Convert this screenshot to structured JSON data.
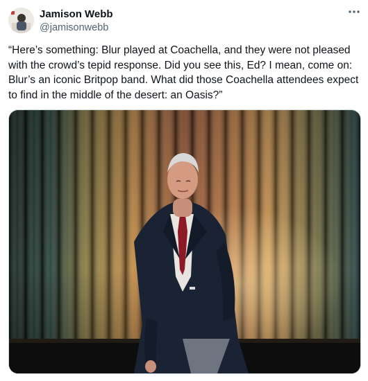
{
  "author": {
    "display_name": "Jamison Webb",
    "handle": "@jamisonwebb",
    "avatar_icon": "person-avatar"
  },
  "more_icon": "ellipsis-icon",
  "tweet": {
    "text": "“Here’s something: Blur played at Coachella, and they were not pleased with the crowd’s tepid response. Did you see this, Ed? I mean, come on: Blur’s an iconic Britpop band. What did those Coachella attendees expect to find in the middle of the desert: an Oasis?”"
  },
  "media": {
    "kind": "photo",
    "palette": {
      "curtain_dark": "#12221c",
      "curtain_teal": "#214a44",
      "curtain_gold": "#c99a4a",
      "curtain_orange": "#b8653a",
      "jacket": "#1a2333",
      "tie": "#8b1a26",
      "floor": "#101010"
    }
  },
  "colors": {
    "text_primary": "#0f1419",
    "text_secondary": "#536471",
    "border": "#cfd9de"
  }
}
